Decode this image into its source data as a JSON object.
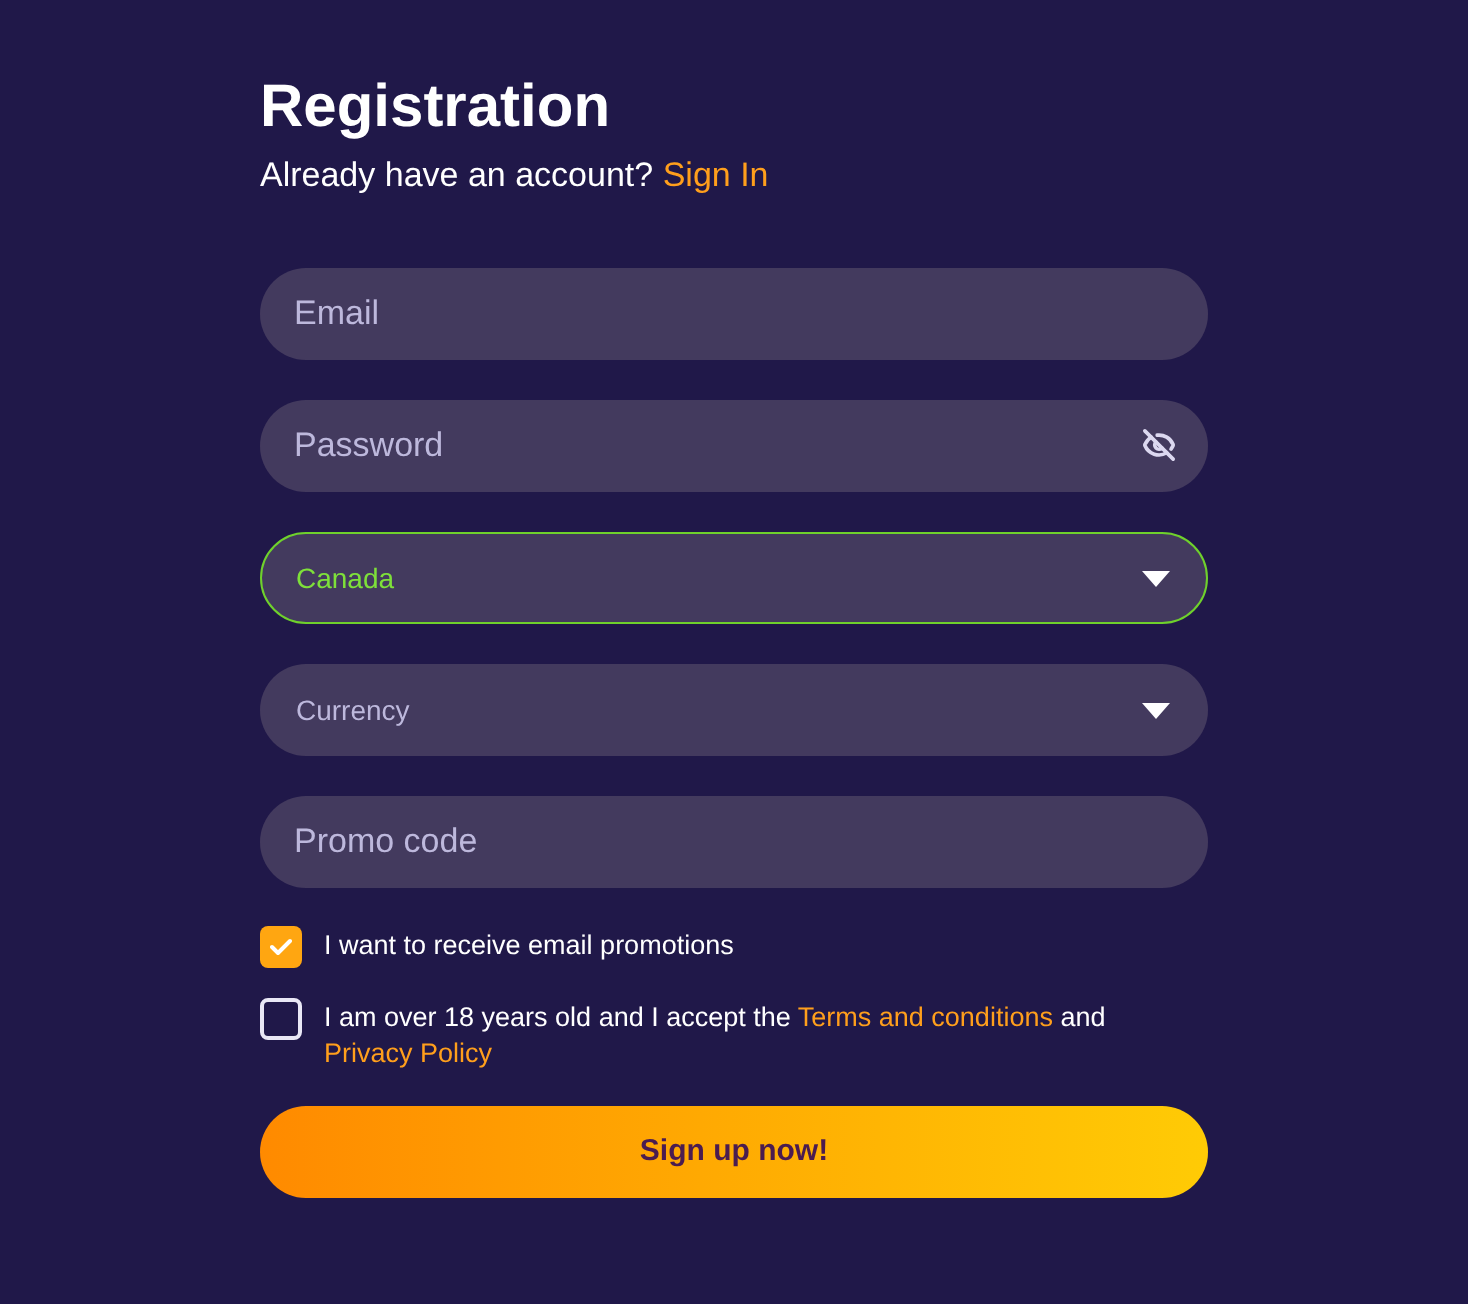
{
  "title": "Registration",
  "subtitle": {
    "text": "Already have an account?",
    "link": "Sign In"
  },
  "fields": [
    {
      "kind": "text",
      "placeholder": "Email"
    },
    {
      "kind": "password",
      "placeholder": "Password"
    },
    {
      "kind": "select",
      "value": "Canada",
      "valid": true
    },
    {
      "kind": "select",
      "placeholder": "Currency",
      "valid": false
    },
    {
      "kind": "text",
      "placeholder": "Promo code"
    }
  ],
  "checkboxes": [
    {
      "checked": true,
      "parts": [
        {
          "kind": "text",
          "text": "I want to receive email promotions"
        }
      ]
    },
    {
      "checked": false,
      "parts": [
        {
          "kind": "text",
          "text": "I am over 18 years old and I accept the "
        },
        {
          "kind": "link",
          "text": "Terms and conditions"
        },
        {
          "kind": "text",
          "text": " and "
        },
        {
          "kind": "link",
          "text": "Privacy Policy"
        }
      ]
    }
  ],
  "button": "Sign up now!"
}
